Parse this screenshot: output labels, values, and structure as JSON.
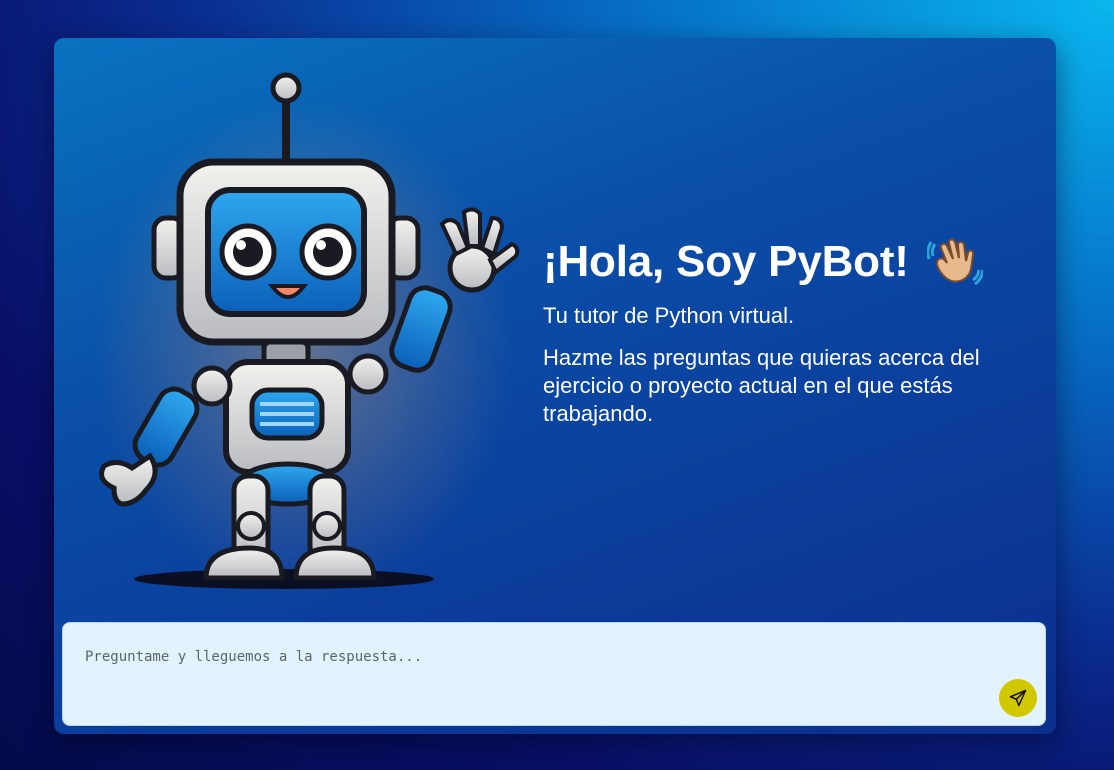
{
  "welcome": {
    "title": "¡Hola, Soy PyBot!",
    "subtitle": "Tu tutor de Python virtual.",
    "description": "Hazme las preguntas que quieras acerca del ejercicio o proyecto actual en el que estás trabajando."
  },
  "chat_input": {
    "placeholder": "Preguntame y lleguemos a la respuesta..."
  },
  "icons": {
    "mascot": "robot-mascot-illustration",
    "wave": "waving-hand-icon",
    "send": "send-paper-plane-icon"
  },
  "colors": {
    "send_button": "#d2c800",
    "input_background": "#e3f3fe",
    "card_background": "#0a4fa8"
  }
}
